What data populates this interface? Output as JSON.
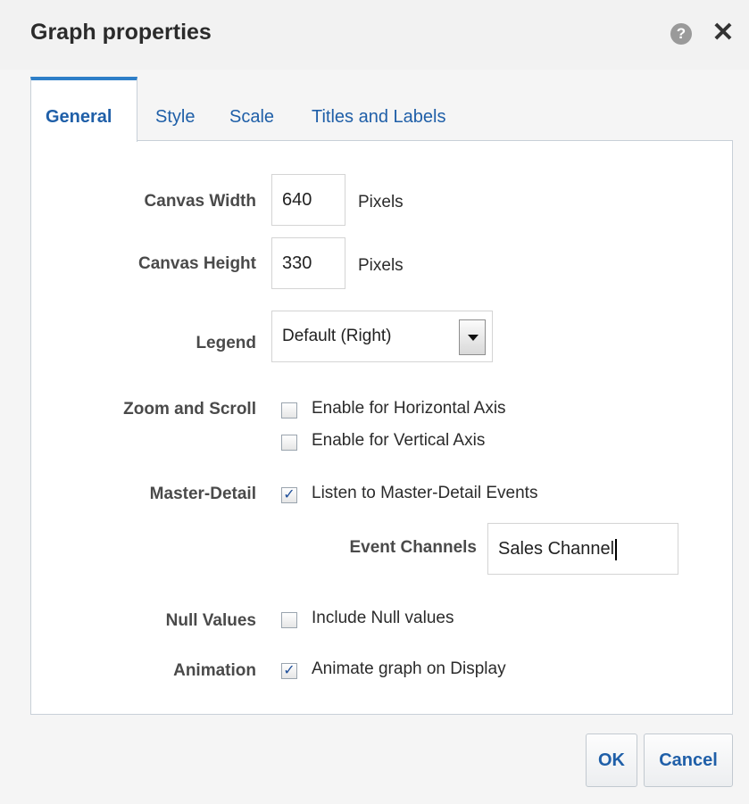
{
  "dialog": {
    "title": "Graph properties",
    "help_icon": "question-circle-icon",
    "close_icon": "close-icon"
  },
  "tabs": [
    {
      "label": "General",
      "active": true
    },
    {
      "label": "Style",
      "active": false
    },
    {
      "label": "Scale",
      "active": false
    },
    {
      "label": "Titles and Labels",
      "active": false
    }
  ],
  "general": {
    "canvas_width": {
      "label": "Canvas Width",
      "value": "640",
      "unit": "Pixels"
    },
    "canvas_height": {
      "label": "Canvas Height",
      "value": "330",
      "unit": "Pixels"
    },
    "legend": {
      "label": "Legend",
      "selected": "Default (Right)"
    },
    "zoom_scroll": {
      "label": "Zoom and Scroll",
      "horizontal": {
        "label": "Enable for Horizontal Axis",
        "checked": false
      },
      "vertical": {
        "label": "Enable for Vertical Axis",
        "checked": false
      }
    },
    "master_detail": {
      "label": "Master-Detail",
      "listen": {
        "label": "Listen to Master-Detail Events",
        "checked": true
      },
      "event_channels": {
        "label": "Event Channels",
        "value": "Sales Channel"
      }
    },
    "null_values": {
      "label": "Null Values",
      "include": {
        "label": "Include Null values",
        "checked": false
      }
    },
    "animation": {
      "label": "Animation",
      "animate": {
        "label": "Animate graph on Display",
        "checked": true
      }
    }
  },
  "buttons": {
    "ok": "OK",
    "cancel": "Cancel"
  },
  "colors": {
    "accent": "#2e7fc8",
    "link": "#1f5fa8"
  }
}
